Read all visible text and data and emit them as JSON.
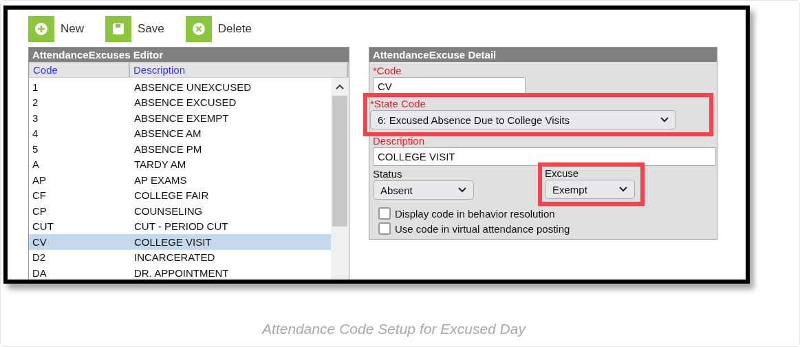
{
  "toolbar": [
    {
      "label": "New",
      "kind": "new"
    },
    {
      "label": "Save",
      "kind": "save"
    },
    {
      "label": "Delete",
      "kind": "delete"
    }
  ],
  "editor": {
    "title": "AttendanceExcuses Editor",
    "columns": [
      "Code",
      "Description"
    ],
    "rows": [
      {
        "code": "1",
        "description": "ABSENCE UNEXCUSED",
        "selected": false
      },
      {
        "code": "2",
        "description": "ABSENCE EXCUSED",
        "selected": false
      },
      {
        "code": "3",
        "description": "ABSENCE EXEMPT",
        "selected": false
      },
      {
        "code": "4",
        "description": "ABSENCE AM",
        "selected": false
      },
      {
        "code": "5",
        "description": "ABSENCE PM",
        "selected": false
      },
      {
        "code": "A",
        "description": "TARDY AM",
        "selected": false
      },
      {
        "code": "AP",
        "description": "AP EXAMS",
        "selected": false
      },
      {
        "code": "CF",
        "description": "COLLEGE FAIR",
        "selected": false
      },
      {
        "code": "CP",
        "description": "COUNSELING",
        "selected": false
      },
      {
        "code": "CUT",
        "description": "CUT - PERIOD CUT",
        "selected": false
      },
      {
        "code": "CV",
        "description": "COLLEGE VISIT",
        "selected": true
      },
      {
        "code": "D2",
        "description": "INCARCERATED",
        "selected": false
      },
      {
        "code": "DA",
        "description": "DR. APPOINTMENT",
        "selected": false
      }
    ]
  },
  "detail": {
    "title": "AttendanceExcuse Detail",
    "code": {
      "label": "*Code",
      "value": "CV",
      "required": true,
      "highlighted": false
    },
    "state_code": {
      "label": "*State Code",
      "value": "6: Excused Absence Due to College Visits",
      "required": true,
      "highlighted": true
    },
    "description": {
      "label": "Description",
      "value": "COLLEGE VISIT",
      "required": true,
      "highlighted": false
    },
    "status": {
      "label": "Status",
      "value": "Absent",
      "required": false,
      "highlighted": false
    },
    "excuse": {
      "label": "Excuse",
      "value": "Exempt",
      "required": false,
      "highlighted": true
    },
    "checkboxes": [
      {
        "label": "Display code in behavior resolution",
        "checked": false
      },
      {
        "label": "Use code in virtual attendance posting",
        "checked": false
      }
    ]
  },
  "caption": "Attendance Code Setup for Excused Day"
}
